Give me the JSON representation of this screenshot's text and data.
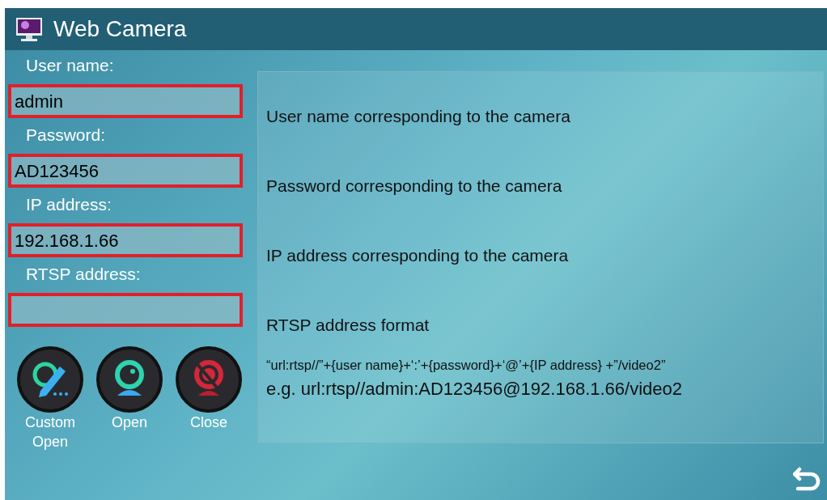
{
  "window": {
    "title": "Web Camera"
  },
  "fields": [
    {
      "label": "User name:",
      "value": "admin",
      "description": "User name corresponding to the camera"
    },
    {
      "label": "Password:",
      "value": "AD123456",
      "description": "Password corresponding to the camera"
    },
    {
      "label": "IP address:",
      "value": "192.168.1.66",
      "description": "IP address corresponding to the camera"
    },
    {
      "label": "RTSP address:",
      "description": "RTSP address format"
    }
  ],
  "format": "“url:rtsp//”+{user name}+‘:’+{password}+‘@’+{IP address} +”/video2”",
  "example": "e.g. url:rtsp//admin:AD123456@192.168.1.66/video2",
  "buttons": [
    {
      "label": "Custom Open",
      "kind": "custom"
    },
    {
      "label": "Open",
      "kind": "open"
    },
    {
      "label": "Close",
      "kind": "close"
    }
  ]
}
